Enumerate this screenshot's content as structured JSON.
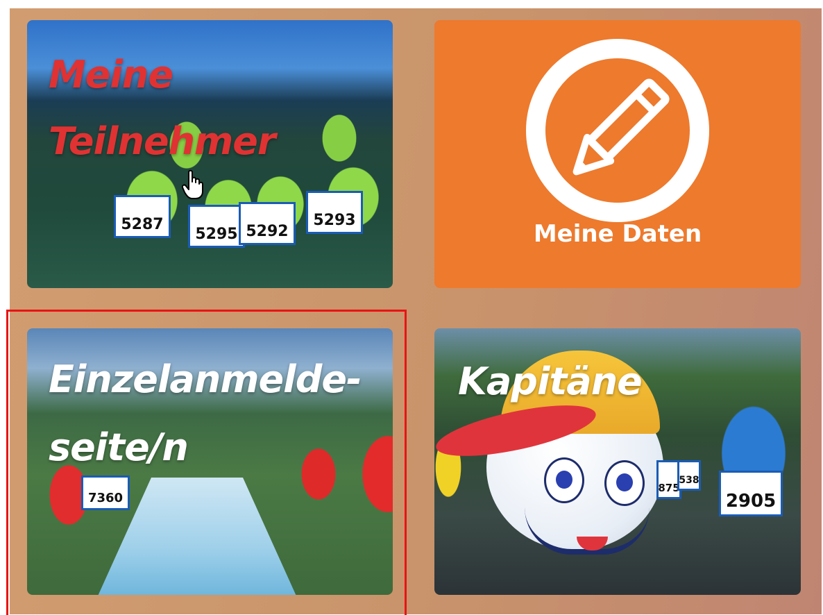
{
  "tiles": [
    {
      "title": "Meine Teilnehmer"
    },
    {
      "label": "Meine Daten",
      "icon": "pencil-icon"
    },
    {
      "title": "Einzelanmelde-seite/n"
    },
    {
      "title": "Kapitäne"
    }
  ],
  "bibs": {
    "tile1": [
      "5287",
      "5295",
      "5292",
      "5293"
    ],
    "tile3": [
      "7360"
    ],
    "tile4": [
      "2905",
      "875",
      "538"
    ]
  },
  "colors": {
    "panel": "#c9946b",
    "orange_tile": "#ed7a2d",
    "title_red": "#e03232",
    "highlight": "#e81414"
  },
  "cursor": "hand-pointer-icon"
}
